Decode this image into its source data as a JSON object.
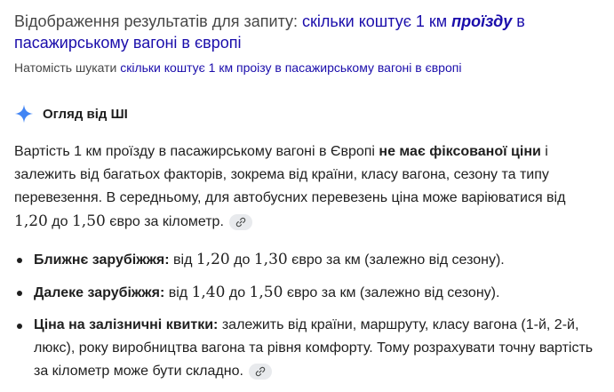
{
  "header": {
    "showing_prefix": "Відображення результатів для запиту: ",
    "query_before": "скільки коштує 1 км ",
    "query_emph": "проїзду",
    "query_after": " в пасажирському вагоні в європі",
    "instead_prefix": "Натомість шукати ",
    "instead_link": "скільки коштує 1 км проізу в пасажирському вагоні в європі"
  },
  "ai_overview": {
    "icon": "sparkle-icon",
    "title": "Огляд від ШІ",
    "accent_color": "#4285f4"
  },
  "paragraph": {
    "t1": "Вартість 1 км проїзду в пасажирському вагоні в Європі ",
    "bold1": "не має фіксованої ціни",
    "t2": " і залежить від багатьох факторів, зокрема від країни, класу вагона, сезону та типу перевезення. В середньому, для автобусних перевезень ціна може варіюватися від ",
    "v1": "1,20",
    "t3": " до ",
    "v2": "1,50",
    "t4": " євро за кілометр."
  },
  "bullets": [
    {
      "label": "Ближнє зарубіжжя:",
      "t1": " від ",
      "v1": "1,20",
      "t2": " до ",
      "v2": "1,30",
      "t3": " євро за км (залежно від сезону)."
    },
    {
      "label": "Далеке зарубіжжя:",
      "t1": " від ",
      "v1": "1,40",
      "t2": " до ",
      "v2": "1,50",
      "t3": " євро за км (залежно від сезону)."
    },
    {
      "label": "Ціна на залізничні квитки:",
      "text": " залежить від країни, маршруту, класу вагона (1-й, 2-й, люкс), року виробництва вагона та рівня комфорту. Тому розрахувати точну вартість за кілометр може бути складно."
    }
  ],
  "link_chip_icon": "link-icon"
}
